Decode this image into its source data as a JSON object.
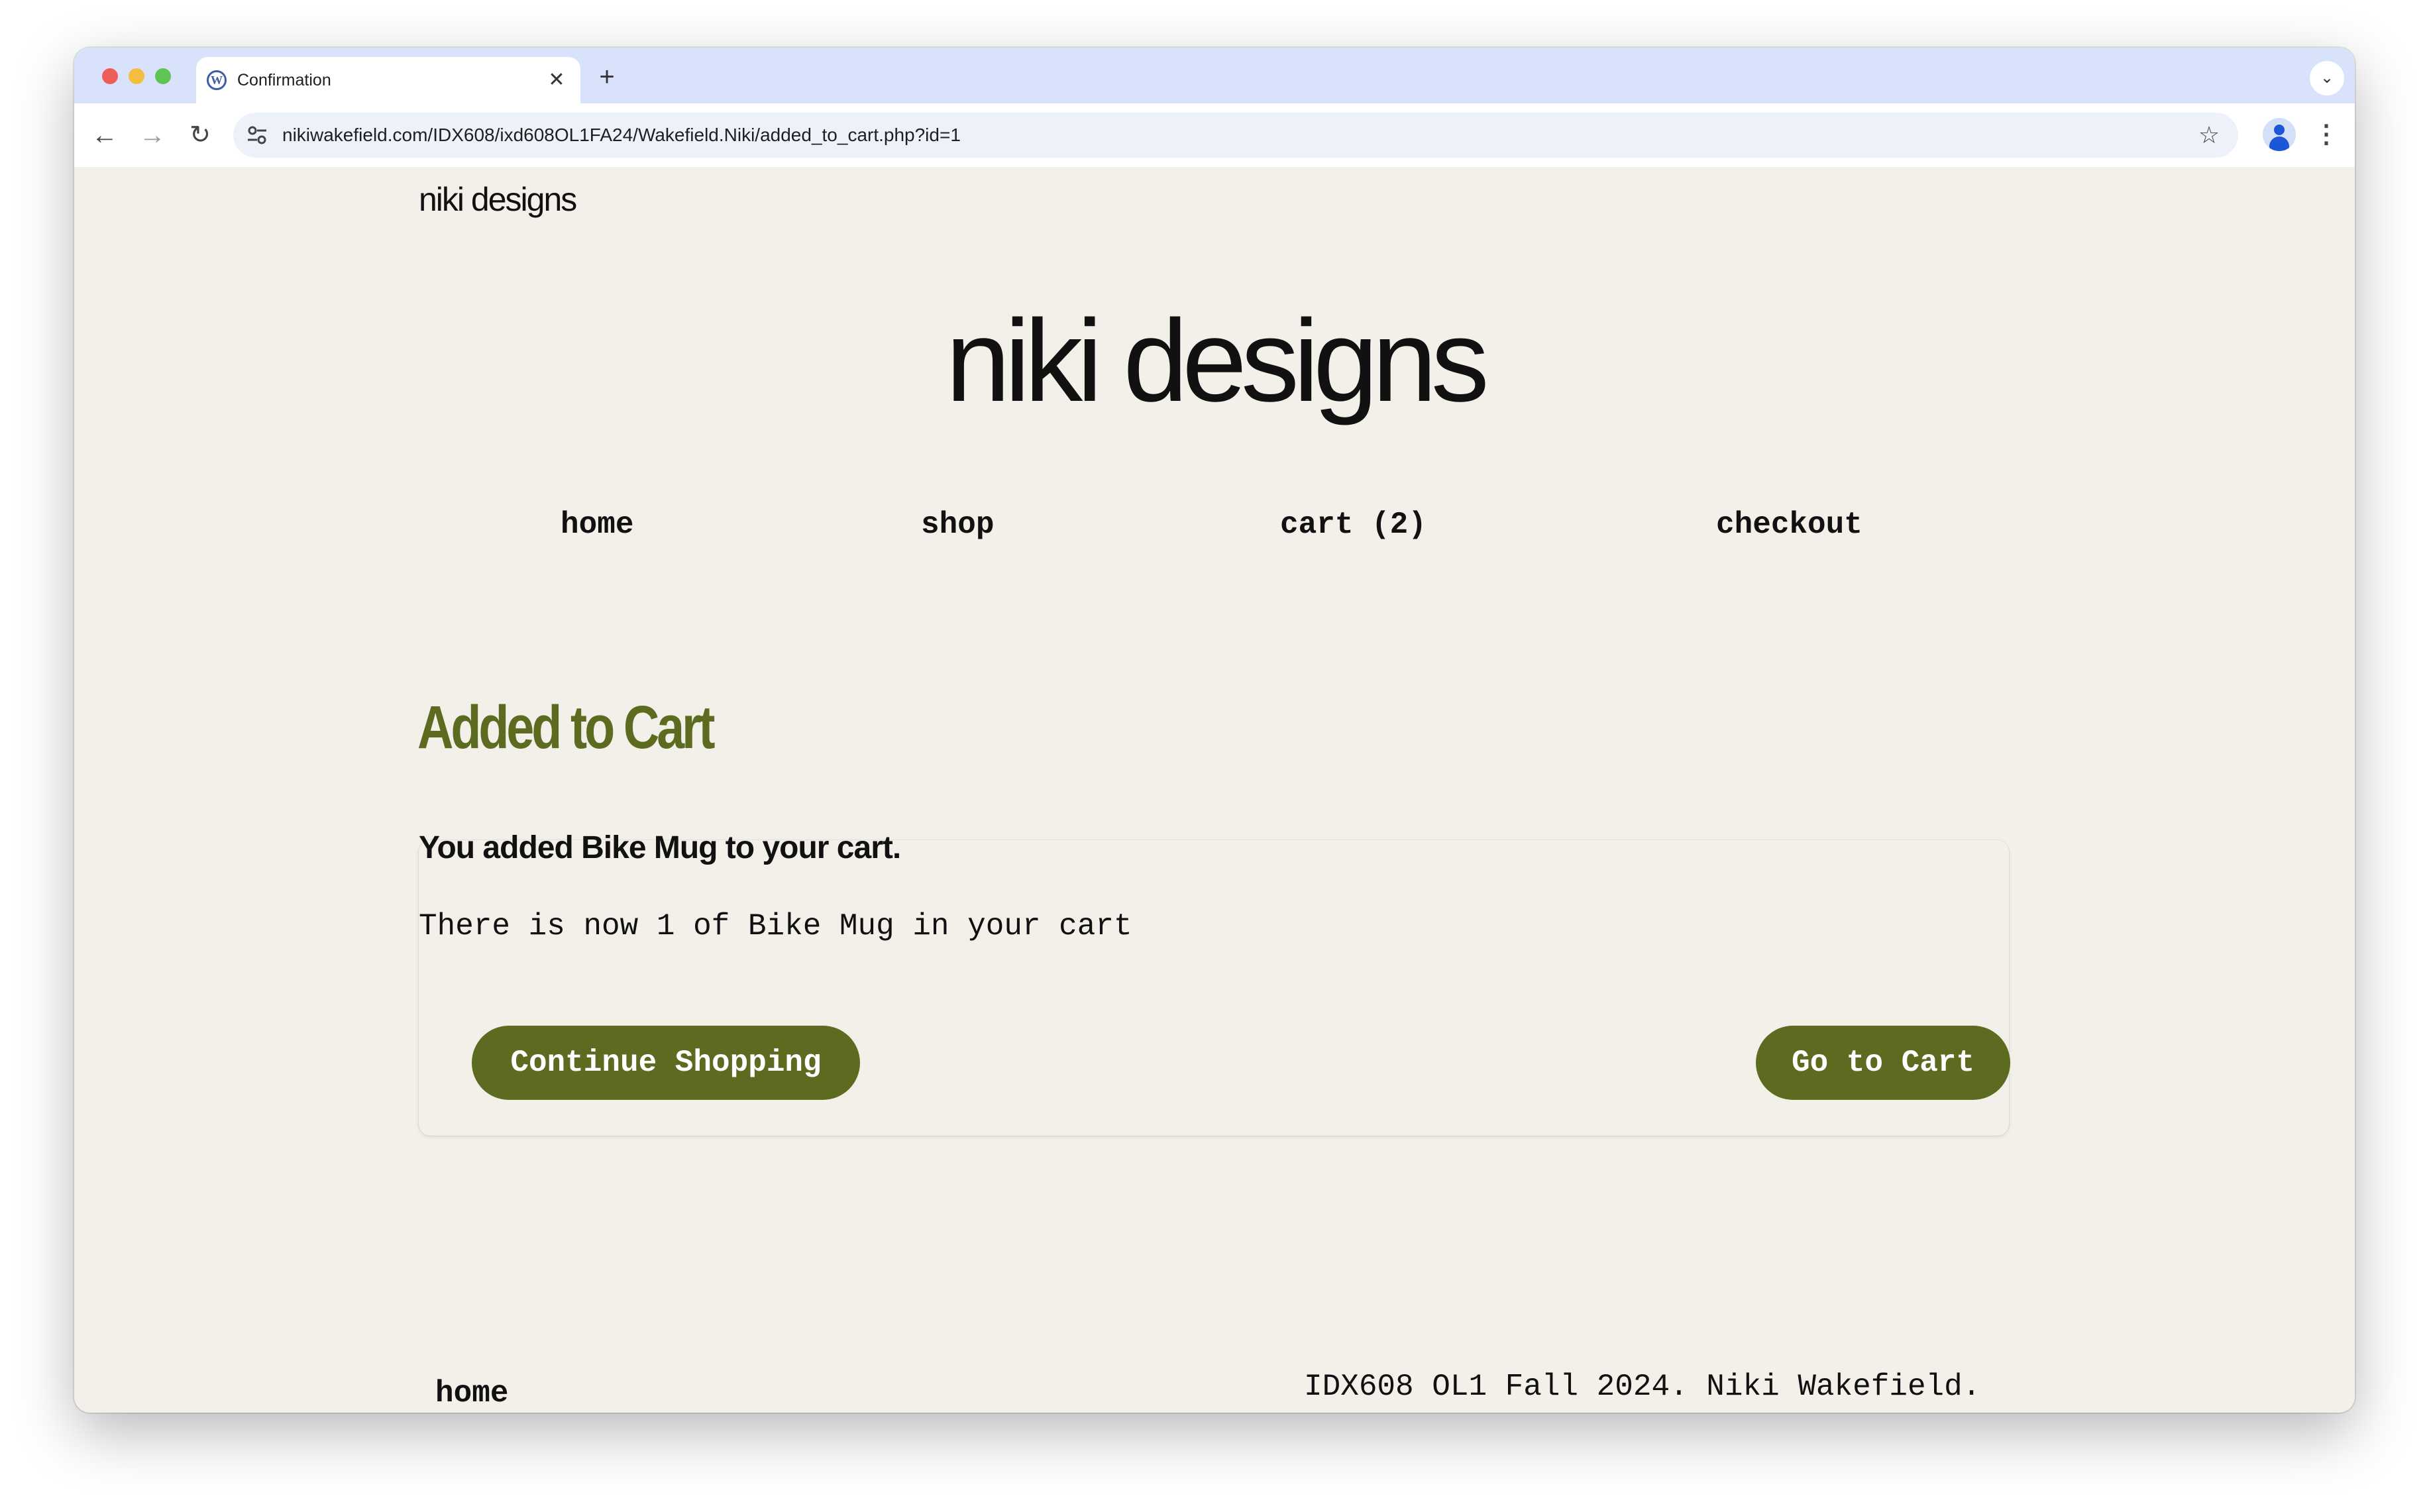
{
  "browser": {
    "tab": {
      "title": "Confirmation",
      "favicon": "wordpress-icon",
      "close": "✕"
    },
    "new_tab": "+",
    "tab_menu": "⌄",
    "nav": {
      "back": "←",
      "forward": "→",
      "reload": "↻"
    },
    "url": "nikiwakefield.com/IDX608/ixd608OL1FA24/Wakefield.Niki/added_to_cart.php?id=1",
    "star": "☆",
    "menu": "⋮"
  },
  "site": {
    "logo_small": "niki designs",
    "logo_large": "niki designs",
    "nav": [
      {
        "label": "home"
      },
      {
        "label": "shop"
      },
      {
        "label": "cart (2)"
      },
      {
        "label": "checkout"
      }
    ]
  },
  "confirmation": {
    "heading": "Added to Cart",
    "message": "You added Bike Mug to your cart.",
    "status": "There is now 1 of Bike Mug in your cart",
    "continue_label": "Continue Shopping",
    "go_to_cart_label": "Go to Cart"
  },
  "footer": {
    "home": "home",
    "copyright": "IDX608 OL1 Fall 2024. Niki Wakefield."
  },
  "colors": {
    "accent": "#5c6b20",
    "page_background": "#f3f0ea",
    "tabstrip": "#d8e3fb"
  }
}
